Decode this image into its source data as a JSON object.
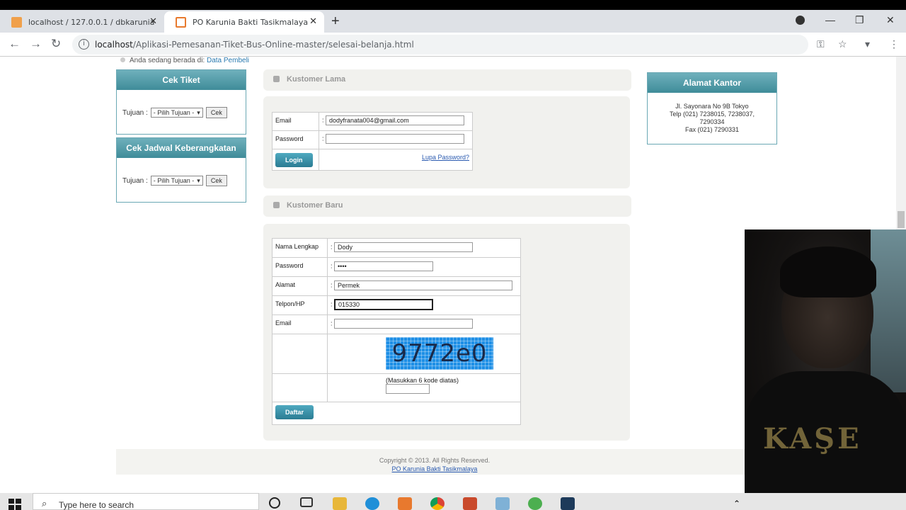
{
  "browser": {
    "tabs": [
      {
        "label": "localhost / 127.0.0.1 / dbkarunia"
      },
      {
        "label": "PO Karunia Bakti Tasikmalaya"
      }
    ],
    "url_host": "localhost",
    "url_path": "/Aplikasi-Pemesanan-Tiket-Bus-Online-master/selesai-belanja.html"
  },
  "breadcrumb": {
    "prefix": "Anda sedang berada di:",
    "link": "Data Pembeli"
  },
  "cek_tiket": {
    "title": "Cek Tiket",
    "label": "Tujuan :",
    "select_value": "- Pilih Tujuan -",
    "button": "Cek"
  },
  "cek_jadwal": {
    "title": "Cek Jadwal Keberangkatan",
    "label": "Tujuan :",
    "select_value": "- Pilih Tujuan -",
    "button": "Cek"
  },
  "kustomer_lama": {
    "title": "Kustomer Lama",
    "email_label": "Email",
    "email_value": "dodyfranata004@gmail.com",
    "password_label": "Password",
    "password_value": "",
    "login_button": "Login",
    "forgot_link": "Lupa Password?"
  },
  "kustomer_baru": {
    "title": "Kustomer Baru",
    "nama_label": "Nama Lengkap",
    "nama_value": "Dody",
    "password_label": "Password",
    "password_value": "••••",
    "alamat_label": "Alamat",
    "alamat_value": "Permek",
    "telpon_label": "Telpon/HP",
    "telpon_value": "015330",
    "email_label": "Email",
    "email_value": "",
    "captcha_text": "9772e0",
    "captcha_hint": "(Masukkan 6 kode diatas)",
    "captcha_input": "",
    "daftar_button": "Daftar"
  },
  "alamat_kantor": {
    "title": "Alamat Kantor",
    "line1": "Jl. Sayonara No 9B Tokyo",
    "line2": "Telp (021) 7238015, 7238037,",
    "line3": "7290334",
    "line4": "Fax (021) 7290331"
  },
  "footer": {
    "copyright": "Copyright © 2013. All Rights Reserved.",
    "link": "PO Karunia Bakti Tasikmalaya"
  },
  "taskbar": {
    "search_placeholder": "Type here to search"
  }
}
